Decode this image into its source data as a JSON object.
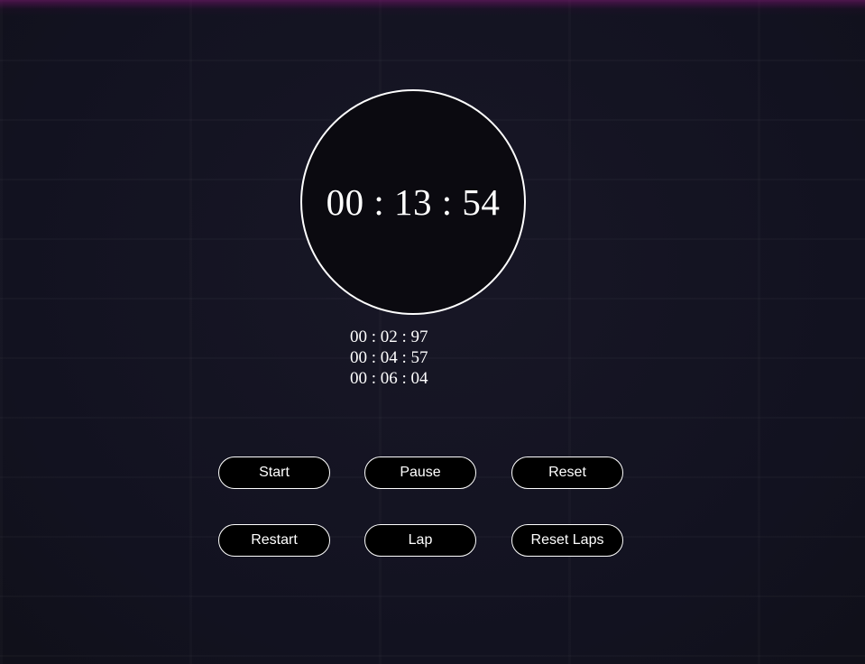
{
  "stopwatch": {
    "display": "00 : 13 : 54"
  },
  "laps": [
    "00 : 02 : 97",
    "00 : 04 : 57",
    "00 : 06 : 04"
  ],
  "controls": {
    "start_label": "Start",
    "pause_label": "Pause",
    "reset_label": "Reset",
    "restart_label": "Restart",
    "lap_label": "Lap",
    "reset_laps_label": "Reset Laps"
  },
  "colors": {
    "background": "#14141f",
    "accent_top": "#78146e",
    "text": "#ffffff",
    "button_bg": "#000000"
  }
}
